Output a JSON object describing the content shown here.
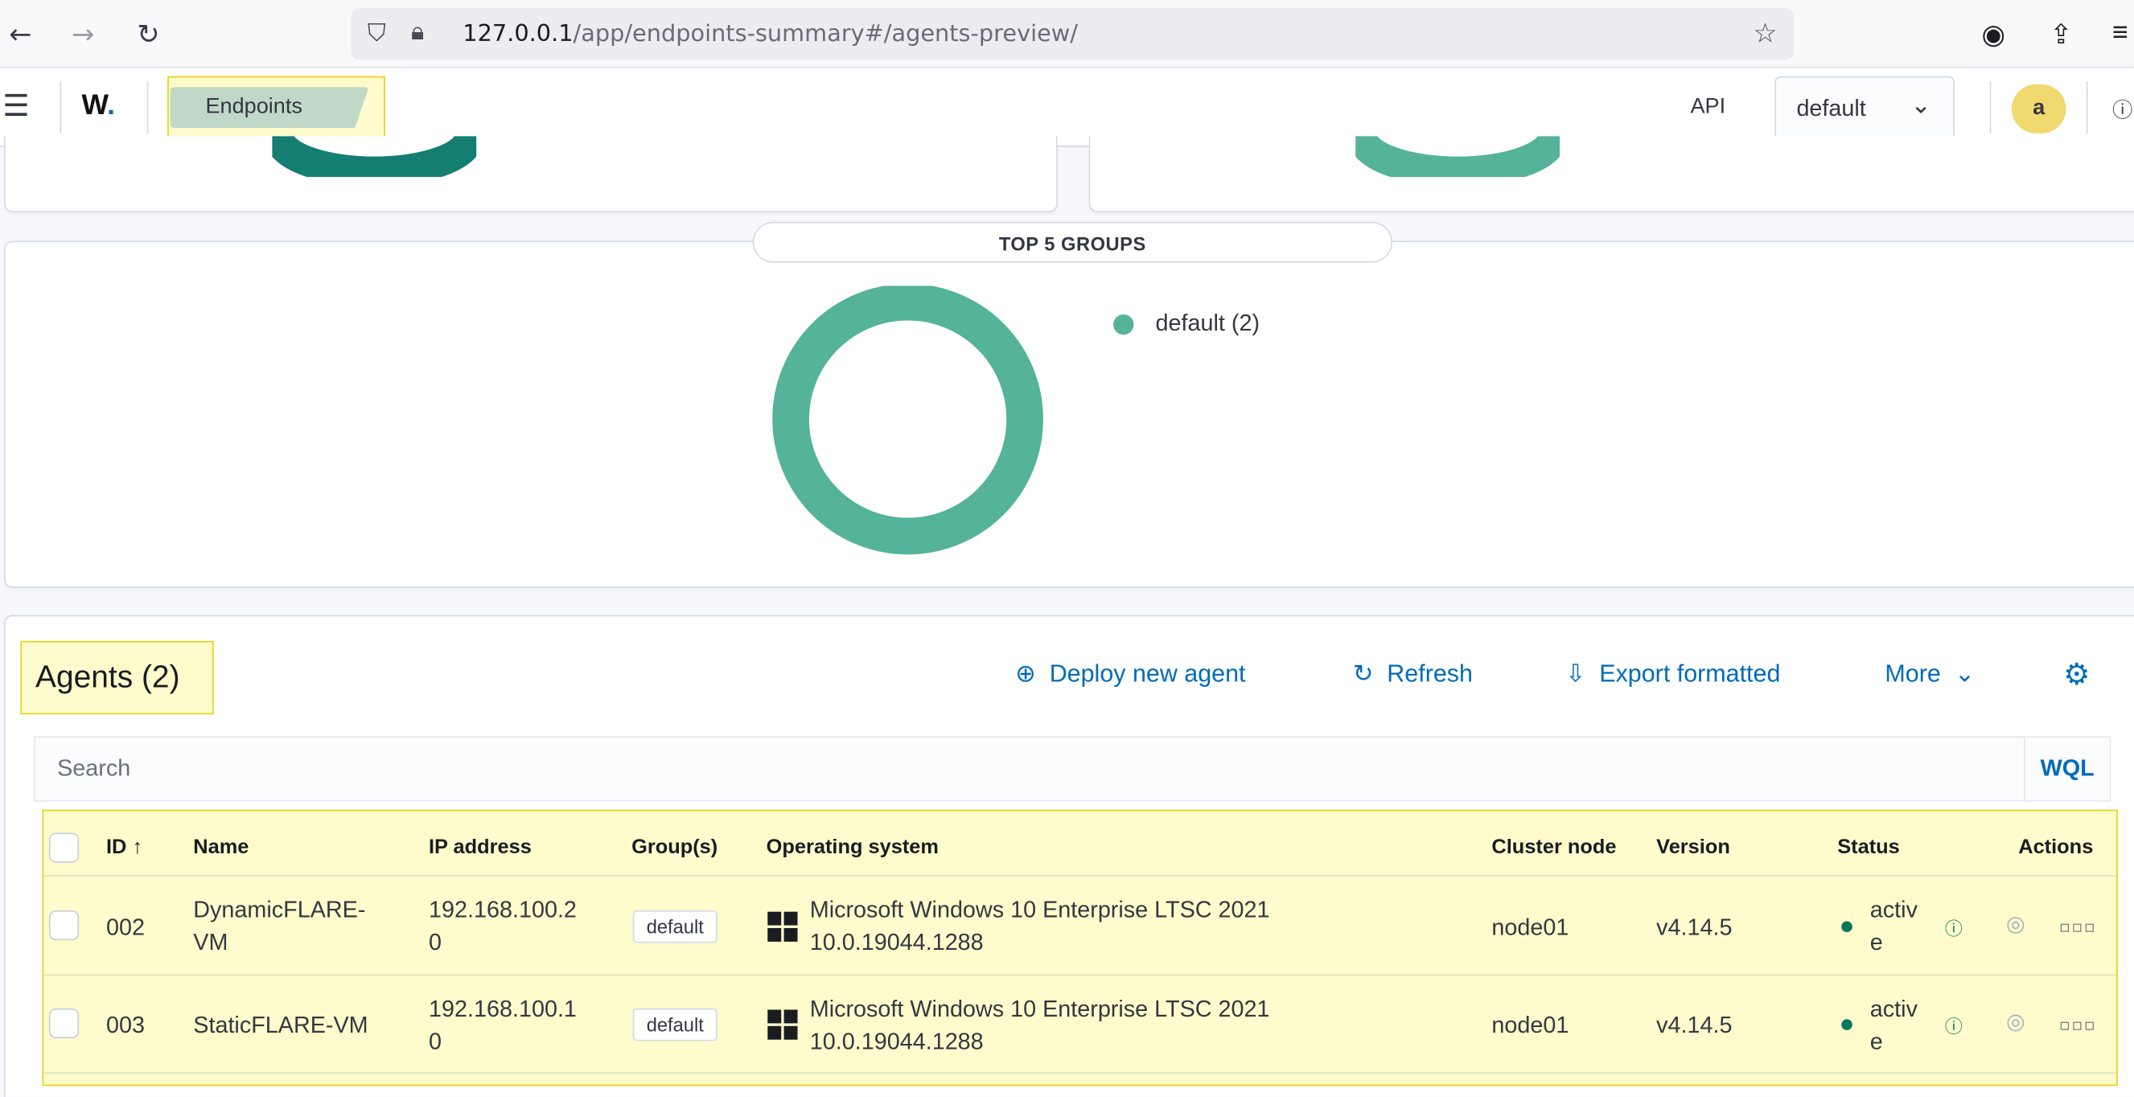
{
  "browser": {
    "back_icon": "arrow-left-icon",
    "forward_icon": "arrow-right-icon",
    "reload_icon": "reload-icon",
    "url_host": "127.0.0.1",
    "url_path": "/app/endpoints-summary#/agents-preview/"
  },
  "header": {
    "logo_text": "W",
    "logo_dot": ".",
    "breadcrumb": "Endpoints",
    "api_label": "API",
    "api_selected": "default",
    "avatar_letter": "a"
  },
  "groups_panel": {
    "title": "TOP 5 GROUPS",
    "legend": [
      {
        "label": "default (2)",
        "color": "#54b399"
      }
    ]
  },
  "chart_data": {
    "type": "pie",
    "title": "TOP 5 GROUPS",
    "categories": [
      "default"
    ],
    "values": [
      2
    ],
    "colors": [
      "#54b399"
    ],
    "legend_position": "right"
  },
  "agents": {
    "title": "Agents (2)",
    "toolbar": {
      "deploy": "Deploy new agent",
      "refresh": "Refresh",
      "export": "Export formatted",
      "more": "More"
    },
    "search_placeholder": "Search",
    "wql_label": "WQL",
    "columns": {
      "id": "ID ↑",
      "name": "Name",
      "ip": "IP address",
      "groups": "Group(s)",
      "os": "Operating system",
      "node": "Cluster node",
      "version": "Version",
      "status": "Status",
      "actions": "Actions"
    },
    "rows": [
      {
        "id": "002",
        "name_1": "DynamicFLARE-",
        "name_2": "VM",
        "ip_1": "192.168.100.2",
        "ip_2": "0",
        "group": "default",
        "os_1": "Microsoft Windows 10 Enterprise LTSC 2021",
        "os_2": "10.0.19044.1288",
        "node": "node01",
        "version": "v4.14.5",
        "status_1": "activ",
        "status_2": "e"
      },
      {
        "id": "003",
        "name_1": "StaticFLARE-VM",
        "name_2": "",
        "ip_1": "192.168.100.1",
        "ip_2": "0",
        "group": "default",
        "os_1": "Microsoft Windows 10 Enterprise LTSC 2021",
        "os_2": "10.0.19044.1288",
        "node": "node01",
        "version": "v4.14.5",
        "status_1": "activ",
        "status_2": "e"
      }
    ]
  }
}
